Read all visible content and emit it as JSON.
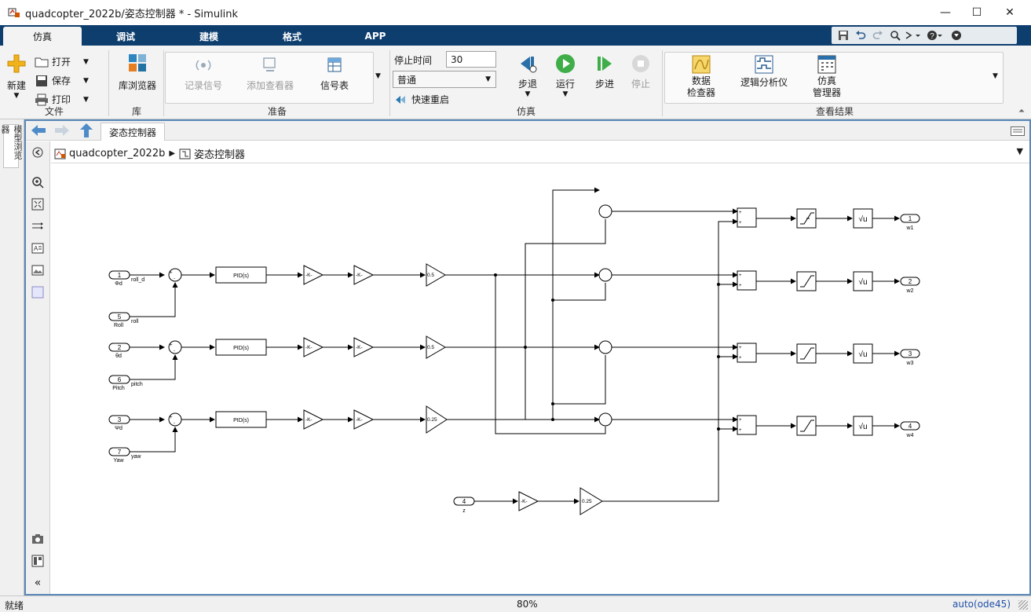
{
  "window": {
    "title": "quadcopter_2022b/姿态控制器 * - Simulink",
    "minimize": "—",
    "maximize": "☐",
    "close": "✕"
  },
  "tabs": [
    {
      "label": "仿真",
      "active": true
    },
    {
      "label": "调试"
    },
    {
      "label": "建模"
    },
    {
      "label": "格式"
    },
    {
      "label": "APP"
    }
  ],
  "ribbon": {
    "file": {
      "label": "文件",
      "new_label": "新建",
      "open_label": "打开",
      "save_label": "保存",
      "print_label": "打印"
    },
    "library": {
      "label": "库",
      "browser_label": "库浏览器"
    },
    "prepare": {
      "label": "准备",
      "log_signal": "记录信号",
      "add_viewer": "添加查看器",
      "signal_table": "信号表"
    },
    "simulate": {
      "label": "仿真",
      "stop_time_label": "停止时间",
      "stop_time_value": "30",
      "mode_value": "普通",
      "fast_restart": "快速重启",
      "step_back": "步退",
      "run": "运行",
      "step_forward": "步进",
      "stop": "停止"
    },
    "results": {
      "label": "查看结果",
      "data_inspector_1": "数据",
      "data_inspector_2": "检查器",
      "logic_analyzer": "逻辑分析仪",
      "sim_manager_1": "仿真",
      "sim_manager_2": "管理器"
    }
  },
  "sidebar": {
    "model_browser": "模型浏览器"
  },
  "editor": {
    "doc_tab": "姿态控制器",
    "breadcrumb_root": "quadcopter_2022b",
    "breadcrumb_child": "姿态控制器"
  },
  "diagram": {
    "inports": [
      {
        "num": "1",
        "name": "Φd",
        "signal": "roll_d"
      },
      {
        "num": "5",
        "name": "Roll",
        "signal": "roll"
      },
      {
        "num": "2",
        "name": "θd",
        "signal": ""
      },
      {
        "num": "6",
        "name": "Pitch",
        "signal": "pitch"
      },
      {
        "num": "3",
        "name": "Ψd",
        "signal": ""
      },
      {
        "num": "7",
        "name": "Yaw",
        "signal": "yaw"
      },
      {
        "num": "4",
        "name": "z",
        "signal": ""
      }
    ],
    "outports": [
      {
        "num": "1",
        "name": "w1"
      },
      {
        "num": "2",
        "name": "w2"
      },
      {
        "num": "3",
        "name": "w3"
      },
      {
        "num": "4",
        "name": "w4"
      }
    ],
    "pid_label": "PID(s)",
    "gain_label": "-K-",
    "gain_05": "0.5",
    "gain_025": "0.25",
    "sqrt_label": "√u"
  },
  "status": {
    "left": "就绪",
    "zoom": "80%",
    "solver": "auto(ode45)"
  }
}
